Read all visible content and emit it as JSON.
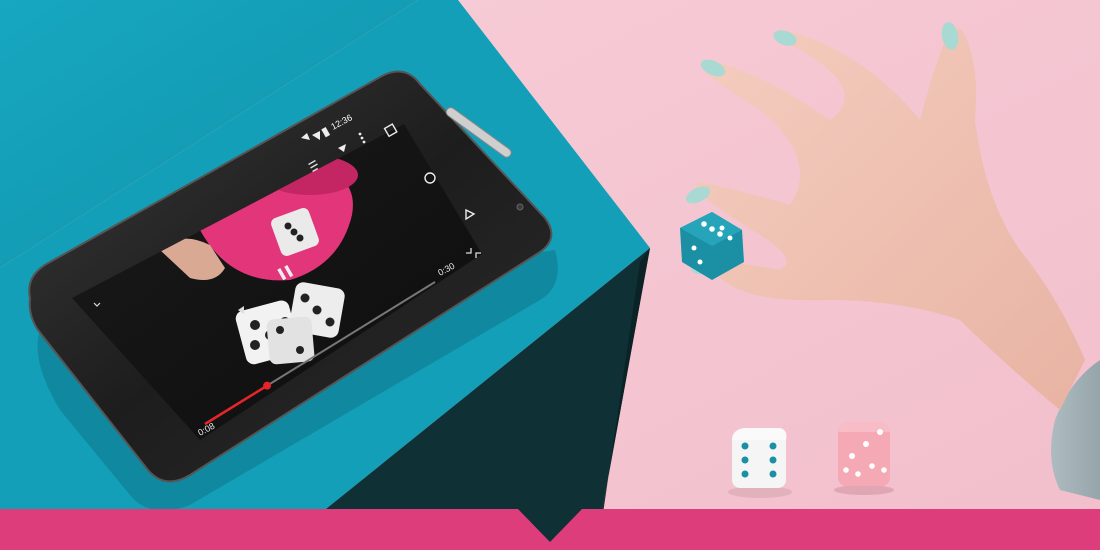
{
  "phone": {
    "status_time": "12:36",
    "elapsed_time": "0:08",
    "total_time": "0:30",
    "progress": 0.27
  },
  "colors": {
    "pink_background": "#f5c7d3",
    "teal_box": "#159fb8",
    "box_shadow_side": "#0e2e33",
    "banner": "#dd3d7b",
    "progress_accent": "#e5252a",
    "nail_polish": "#a9d9d3",
    "teal_die": "#1b8fa4",
    "pink_die": "#f4a9b4"
  },
  "icons": {
    "status": [
      "wifi-icon",
      "signal-icon",
      "battery-icon"
    ],
    "video_top": [
      "playlist-icon",
      "share-icon",
      "more-icon"
    ],
    "video_controls": [
      "pause-icon",
      "minimize-icon",
      "exit-fullscreen-icon"
    ],
    "nav": [
      "recents-icon",
      "home-icon",
      "back-icon"
    ]
  }
}
